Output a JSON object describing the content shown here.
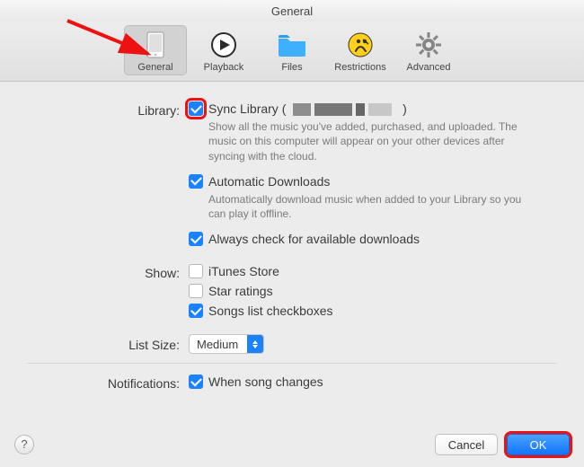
{
  "window": {
    "title": "General"
  },
  "tabs": {
    "general": {
      "label": "General",
      "selected": true
    },
    "playback": {
      "label": "Playback",
      "selected": false
    },
    "files": {
      "label": "Files",
      "selected": false
    },
    "restrictions": {
      "label": "Restrictions",
      "selected": false
    },
    "advanced": {
      "label": "Advanced",
      "selected": false
    }
  },
  "sections": {
    "library": {
      "label": "Library:",
      "sync": {
        "label_prefix": "Sync Library (",
        "label_suffix": ")",
        "checked": true,
        "description": "Show all the music you've added, purchased, and uploaded. The music on this computer will appear on your other devices after syncing with the cloud."
      },
      "auto_downloads": {
        "label": "Automatic Downloads",
        "checked": true,
        "description": "Automatically download music when added to your Library so you can play it offline."
      },
      "check_downloads": {
        "label": "Always check for available downloads",
        "checked": true
      }
    },
    "show": {
      "label": "Show:",
      "itunes_store": {
        "label": "iTunes Store",
        "checked": false
      },
      "star_ratings": {
        "label": "Star ratings",
        "checked": false
      },
      "list_checkboxes": {
        "label": "Songs list checkboxes",
        "checked": true
      }
    },
    "list_size": {
      "label": "List Size:",
      "value": "Medium"
    },
    "notifications": {
      "label": "Notifications:",
      "song_changes": {
        "label": "When song changes",
        "checked": true
      }
    }
  },
  "footer": {
    "help_symbol": "?",
    "cancel": "Cancel",
    "ok": "OK"
  },
  "annotations": {
    "arrow_target": "tab-general",
    "highlighted": [
      "checkbox-sync-library",
      "ok-button"
    ]
  }
}
